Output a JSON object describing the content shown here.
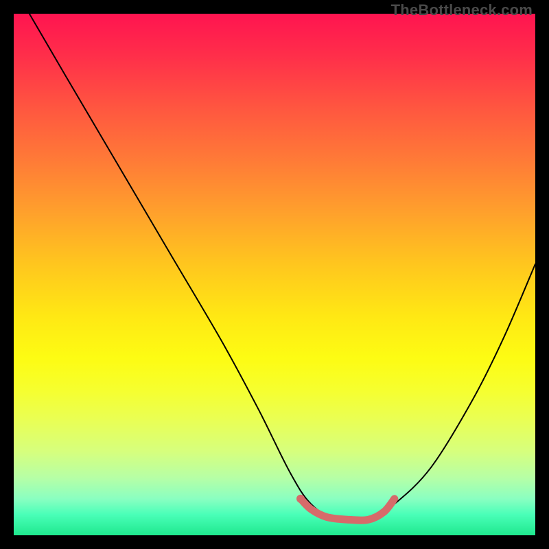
{
  "watermark": "TheBottleneck.com",
  "colors": {
    "curve": "#000000",
    "highlight": "#d66a6a",
    "background_top": "#ff1450",
    "background_bottom": "#1fe88e",
    "frame": "#000000"
  },
  "chart_data": {
    "type": "line",
    "title": "",
    "xlabel": "",
    "ylabel": "",
    "xlim": [
      0,
      100
    ],
    "ylim": [
      0,
      100
    ],
    "grid": false,
    "series": [
      {
        "name": "bottleneck-curve",
        "x": [
          3,
          10,
          20,
          30,
          40,
          47,
          53,
          57,
          62,
          68,
          73,
          80,
          88,
          94,
          100
        ],
        "y": [
          100,
          88,
          71,
          54,
          37,
          24,
          12,
          6,
          3,
          3,
          6,
          13,
          26,
          38,
          52
        ]
      },
      {
        "name": "optimal-range-highlight",
        "x": [
          55,
          57,
          60,
          64,
          68,
          71,
          73
        ],
        "y": [
          7,
          5,
          3.5,
          3,
          3,
          4.5,
          7
        ]
      }
    ],
    "annotations": [
      {
        "name": "highlight-dot",
        "x": 55,
        "y": 7
      }
    ]
  }
}
